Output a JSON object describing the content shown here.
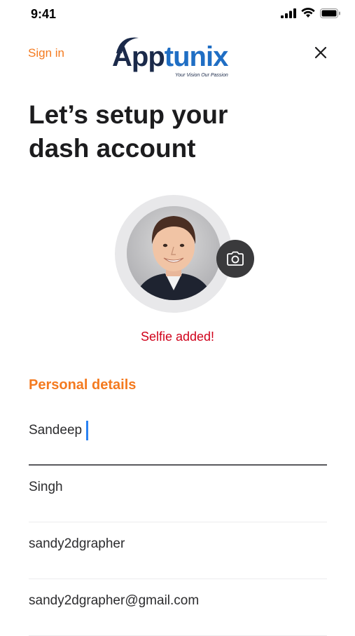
{
  "status_bar": {
    "time": "9:41",
    "icons": [
      "signal-icon",
      "wifi-icon",
      "battery-icon"
    ]
  },
  "nav": {
    "sign_in_label": "Sign in",
    "logo": {
      "part1": "App",
      "part2": "tunix",
      "tagline": "Your Vision Our Passion"
    },
    "close_icon": "close-icon"
  },
  "heading": {
    "line1": "Let’s setup your",
    "line2": "dash account"
  },
  "avatar": {
    "camera_icon": "camera-icon",
    "status_text": "Selfie added!"
  },
  "personal_details": {
    "title": "Personal details",
    "fields": [
      {
        "name": "first-name",
        "value": "Sandeep",
        "active": true
      },
      {
        "name": "last-name",
        "value": "Singh",
        "active": false
      },
      {
        "name": "username",
        "value": "sandy2dgrapher",
        "active": false
      },
      {
        "name": "email",
        "value": "sandy2dgrapher@gmail.com",
        "active": false
      }
    ]
  },
  "colors": {
    "accent": "#f47a1f",
    "status_red": "#d0021b",
    "caret_blue": "#2a82f2",
    "logo_navy": "#1b2a4a",
    "logo_blue": "#1f6ec4"
  }
}
